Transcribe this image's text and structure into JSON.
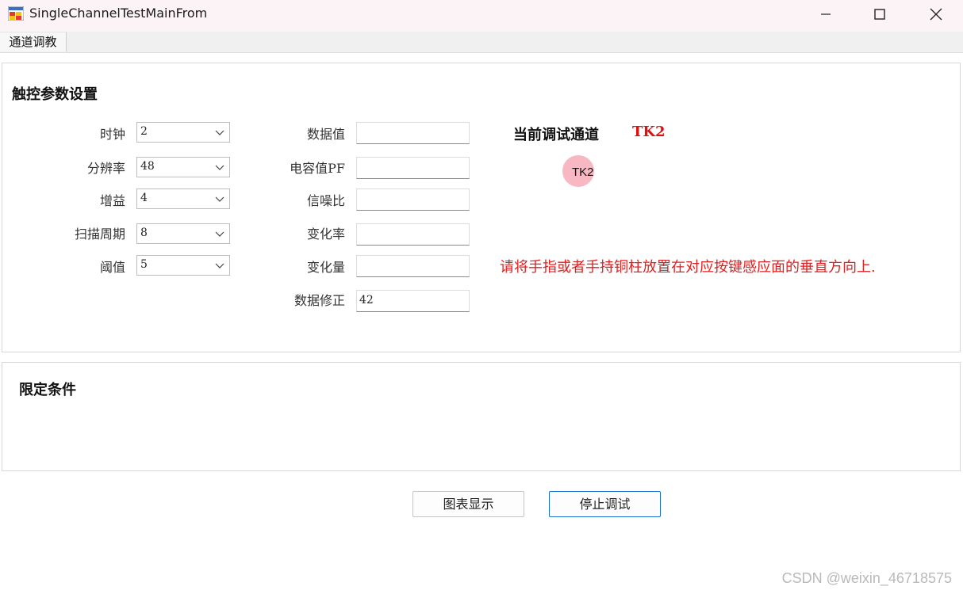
{
  "window": {
    "title": "SingleChannelTestMainFrom",
    "icon": "app-window-icon",
    "controls": [
      "minimize-icon",
      "maximize-icon",
      "close-icon"
    ]
  },
  "tabs": [
    {
      "label": "通道调教",
      "selected": true
    }
  ],
  "touch_params": {
    "title": "触控参数设置",
    "combos": [
      {
        "label": "时钟",
        "value": "2"
      },
      {
        "label": "分辨率",
        "value": "48"
      },
      {
        "label": "增益",
        "value": "4"
      },
      {
        "label": "扫描周期",
        "value": "8"
      },
      {
        "label": "阈值",
        "value": "5"
      }
    ],
    "fields": [
      {
        "label": "数据值",
        "value": ""
      },
      {
        "label": "电容值PF",
        "value": ""
      },
      {
        "label": "信噪比",
        "value": ""
      },
      {
        "label": "变化率",
        "value": ""
      },
      {
        "label": "变化量",
        "value": ""
      },
      {
        "label": "数据修正",
        "value": "42"
      }
    ],
    "current_channel_label": "当前调试通道",
    "current_channel_value": "TK2",
    "indicator_label": "TK2",
    "indicator_color": "#f7b8c4",
    "hint": "请将手指或者手持铜柱放置在对应按键感应面的垂直方向上."
  },
  "limits": {
    "title": "限定条件"
  },
  "buttons": {
    "chart": "图表显示",
    "stop": "停止调试"
  },
  "watermark": "CSDN @weixin_46718575",
  "colors": {
    "accent_red": "#e01010",
    "primary_border": "#1a6fcf"
  }
}
